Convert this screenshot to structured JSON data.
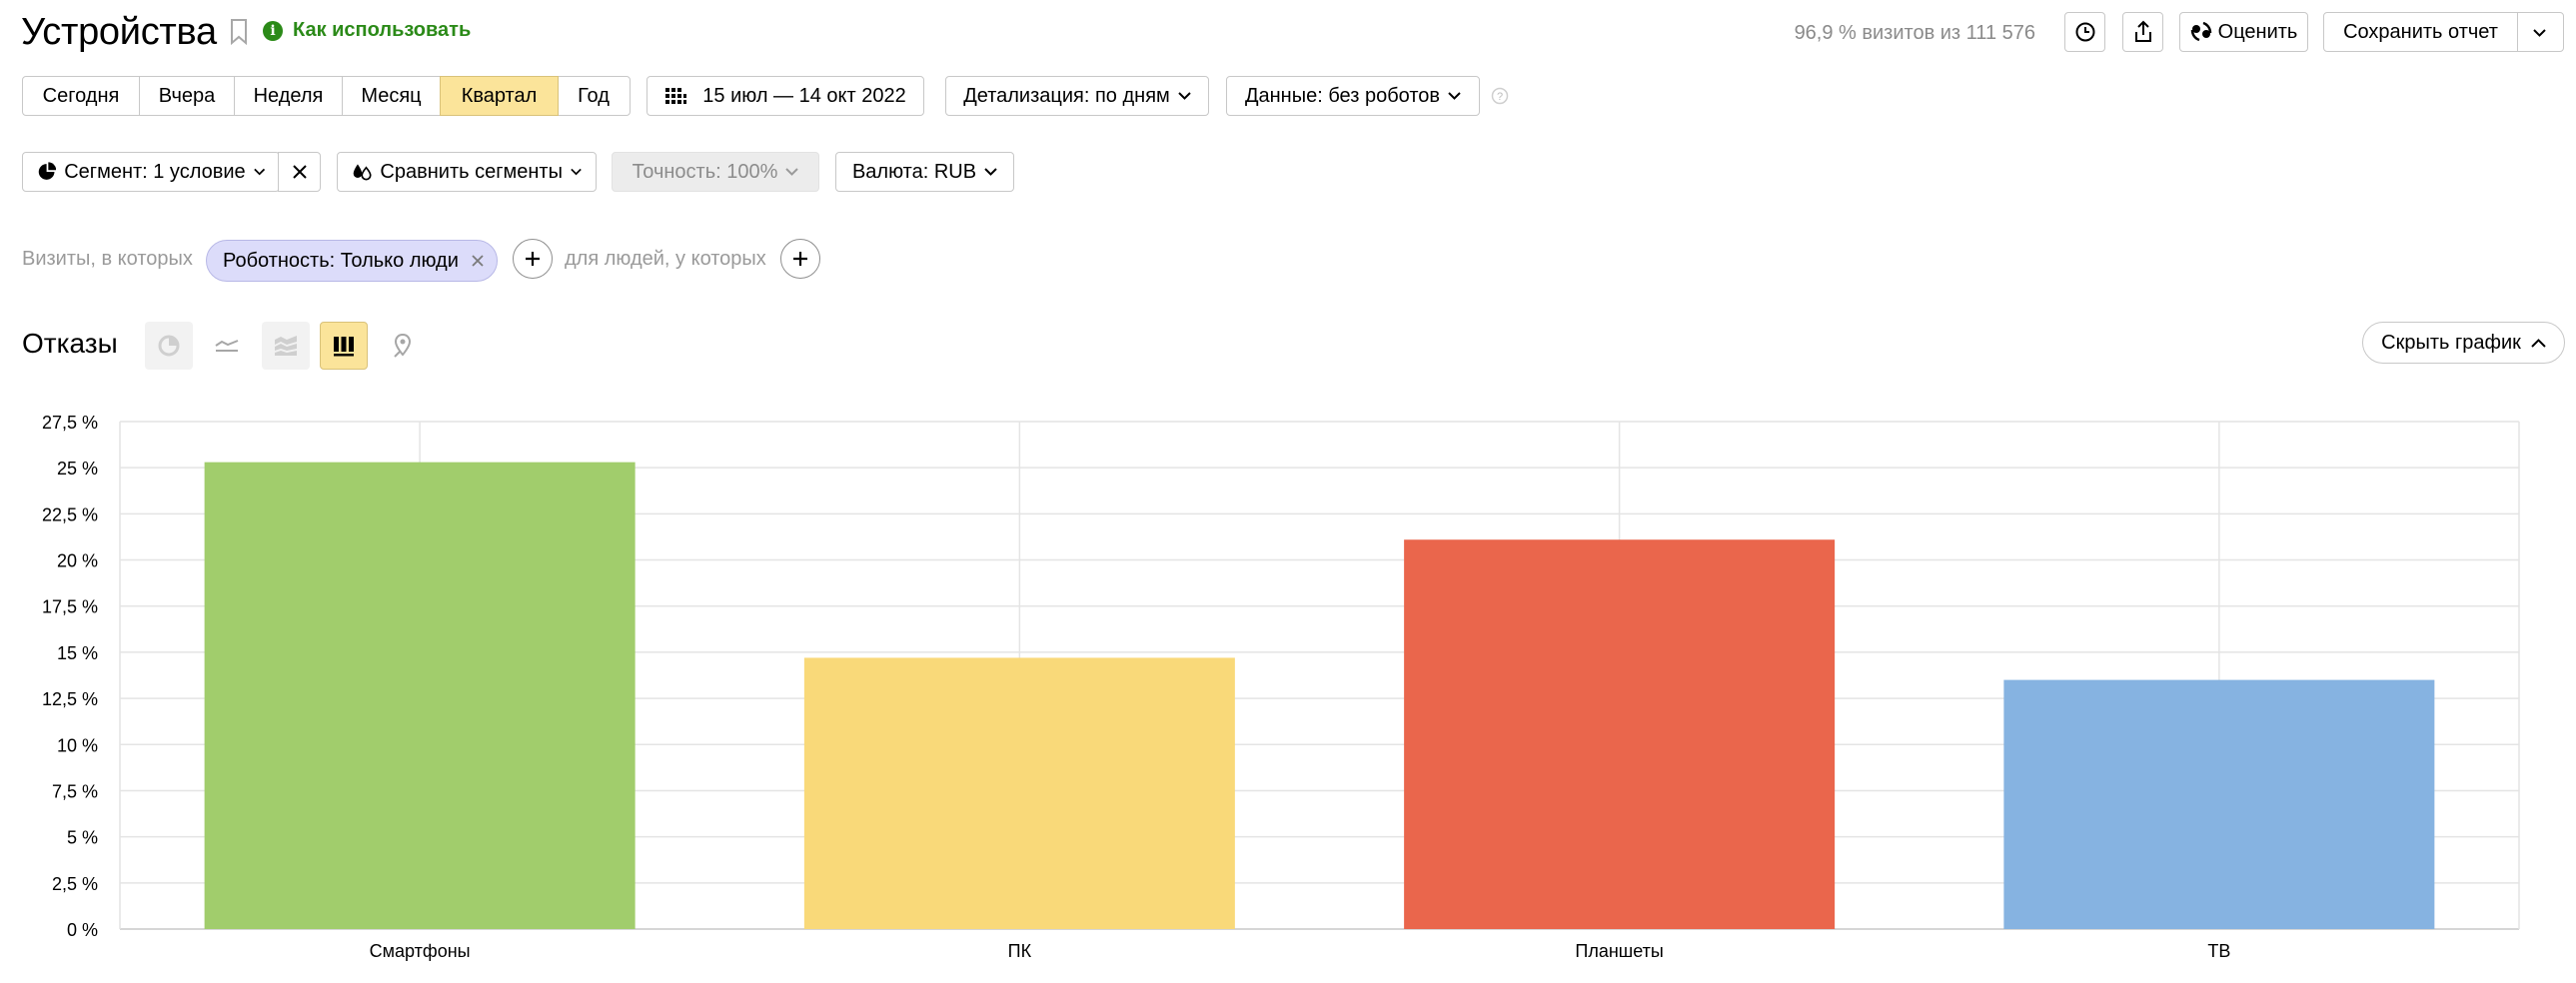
{
  "header": {
    "title": "Устройства",
    "howto_label": "Как использовать",
    "visits_text": "96,9 % визитов из 111 576",
    "rate_label": "Оценить",
    "save_label": "Сохранить отчет"
  },
  "periods": {
    "items": [
      "Сегодня",
      "Вчера",
      "Неделя",
      "Месяц",
      "Квартал",
      "Год"
    ],
    "active": "Квартал"
  },
  "date_range": "15 июл — 14 окт 2022",
  "detail_label": "Детализация: по дням",
  "data_label": "Данные: без роботов",
  "segment_label": "Сегмент: 1 условие",
  "compare_label": "Сравнить сегменты",
  "accuracy_label": "Точность: 100%",
  "currency_label": "Валюта: RUB",
  "filter": {
    "visits_prefix": "Визиты, в которых",
    "chip_label": "Роботность: Только люди",
    "people_prefix": "для людей, у которых"
  },
  "metric_title": "Отказы",
  "chart_types": [
    "pie-chart",
    "line-chart",
    "area-chart",
    "bar-chart",
    "map-chart"
  ],
  "active_chart_type": "bar-chart",
  "hide_chart_label": "Скрыть график",
  "chart_data": {
    "type": "bar",
    "categories": [
      "Смартфоны",
      "ПК",
      "Планшеты",
      "ТВ"
    ],
    "values": [
      25.3,
      14.7,
      21.1,
      13.5
    ],
    "colors": [
      "#a1cd6c",
      "#f9d979",
      "#ea664c",
      "#86b3e1"
    ],
    "ylim": [
      0,
      27.5
    ],
    "yticks": [
      "0 %",
      "2,5 %",
      "5 %",
      "7,5 %",
      "10 %",
      "12,5 %",
      "15 %",
      "17,5 %",
      "20 %",
      "22,5 %",
      "25 %",
      "27,5 %"
    ],
    "grid": true
  }
}
